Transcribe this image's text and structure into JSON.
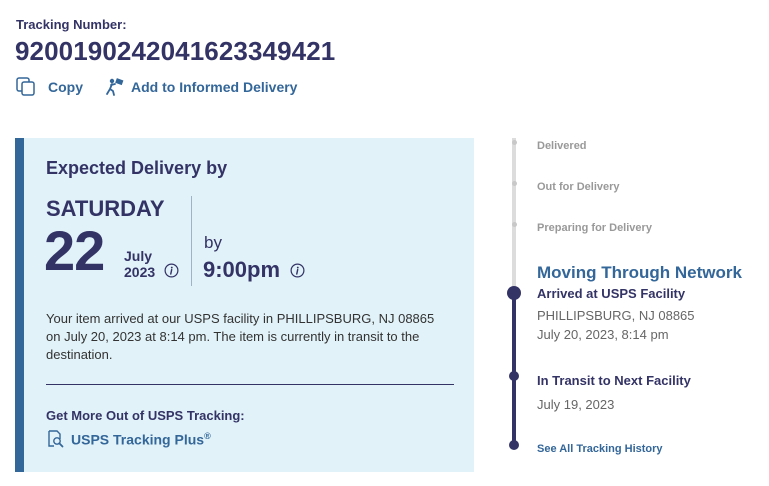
{
  "tracking": {
    "label": "Tracking Number:",
    "number": "9200190242041623349421"
  },
  "actions": {
    "copy_label": "Copy",
    "informed_delivery_label": "Add to Informed Delivery"
  },
  "delivery_card": {
    "heading": "Expected Delivery by",
    "day": "SATURDAY",
    "date": "22",
    "month": "July",
    "year": "2023",
    "by_label": "by",
    "time": "9:00pm",
    "description": "Your item arrived at our USPS facility in PHILLIPSBURG, NJ 08865 on July 20, 2023 at 8:14 pm. The item is currently in transit to the destination.",
    "more_heading": "Get More Out of USPS Tracking:",
    "plus_label": "USPS Tracking Plus",
    "plus_mark": "®"
  },
  "timeline": {
    "delivered": "Delivered",
    "out_for_delivery": "Out for Delivery",
    "preparing": "Preparing for Delivery",
    "current_status": "Moving Through Network",
    "event1_title": "Arrived at USPS Facility",
    "event1_location": "PHILLIPSBURG, NJ 08865",
    "event1_time": "July 20, 2023, 8:14 pm",
    "event2_title": "In Transit to Next Facility",
    "event2_time": "July 19, 2023",
    "history_link": "See All Tracking History"
  },
  "colors": {
    "navy": "#333366",
    "link_blue": "#336699",
    "card_bg": "#e1f2f8",
    "muted": "#999999"
  },
  "icons": {
    "copy": "copy-icon",
    "informed_delivery": "person-mail-icon",
    "info": "info-icon",
    "tracking_plus": "magnifier-document-icon"
  }
}
